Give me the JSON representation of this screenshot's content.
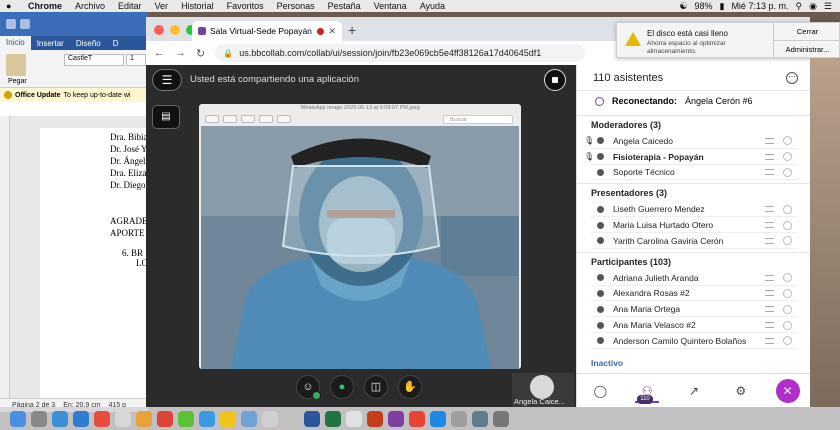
{
  "menubar": {
    "app": "Chrome",
    "items": [
      "Archivo",
      "Editar",
      "Ver",
      "Historial",
      "Favoritos",
      "Personas",
      "Pestaña",
      "Ventana",
      "Ayuda"
    ],
    "battery": "98%",
    "clock": "Mié 7:13 p. m."
  },
  "word": {
    "tabs": [
      "Inicio",
      "Insertar",
      "Diseño",
      "D"
    ],
    "paste_label": "Pegar",
    "font": "CastleT",
    "font_size": "1",
    "infobar_title": "Office Update",
    "infobar_text": "To keep up-to-date wi",
    "doc_lines": [
      "Dra. Bibia",
      "Dr. José Y",
      "Dr. Ángel",
      "Dra. Eliza",
      "Dr. Diego",
      "AGRADE",
      "APORTE",
      "6.  BR",
      "LO"
    ],
    "status_page": "Página 2 de 3",
    "status_pos": "En: 20,9 cm",
    "status_extra": "415 p"
  },
  "chrome": {
    "tab_title": "Sala Virtual-Sede Popayán",
    "url": "us.bbcollab.com/collab/ui/session/join/fb23e069cb5e4ff38126a17d40645df1"
  },
  "collab": {
    "share_text": "Usted está compartiendo una aplicación",
    "shared_window_title": "WhatsApp Image 2020-05-13 at 6:09:07 PM.jpeg",
    "shared_search": "Buscar",
    "self_name": "Angela Caice...",
    "attendees_title": "110 asistentes",
    "reconnect_label": "Reconectando:",
    "reconnect_name": "Ángela Cerón #6",
    "sections": [
      {
        "title": "Moderadores (3)",
        "rows": [
          {
            "name": "Angela Caicedo",
            "bold": false,
            "mic": true
          },
          {
            "name": "Fisioterapia - Popayán",
            "bold": true,
            "mic": true
          },
          {
            "name": "Soporte Técnico",
            "bold": false,
            "mic": false
          }
        ]
      },
      {
        "title": "Presentadores (3)",
        "rows": [
          {
            "name": "Liseth Guerrero Mendez",
            "bold": false,
            "mic": false
          },
          {
            "name": "Maria Luisa Hurtado Otero",
            "bold": false,
            "mic": false
          },
          {
            "name": "Yarith Carolina Gaviria Cerón",
            "bold": false,
            "mic": false
          }
        ]
      },
      {
        "title": "Participantes (103)",
        "rows": [
          {
            "name": "Adriana Julieth Aranda",
            "bold": false,
            "mic": false
          },
          {
            "name": "Alexandra Rosas #2",
            "bold": false,
            "mic": false
          },
          {
            "name": "Ana Maria Ortega",
            "bold": false,
            "mic": false
          },
          {
            "name": "Ana Maria Velasco #2",
            "bold": false,
            "mic": false
          },
          {
            "name": "Anderson Camilo Quintero Bolaños",
            "bold": false,
            "mic": false
          }
        ]
      }
    ],
    "inactive": "Inactivo",
    "badge": "110"
  },
  "notification": {
    "title": "El disco está casi lleno",
    "message": "Ahorra espacio al optimizar almacenamiento.",
    "close": "Cerrar",
    "manage": "Administrar..."
  },
  "colors": {
    "accent": "#7b3fa0",
    "recording": "#d31c1c",
    "mic_on": "#3cc46e",
    "leave": "#b12ecb"
  }
}
